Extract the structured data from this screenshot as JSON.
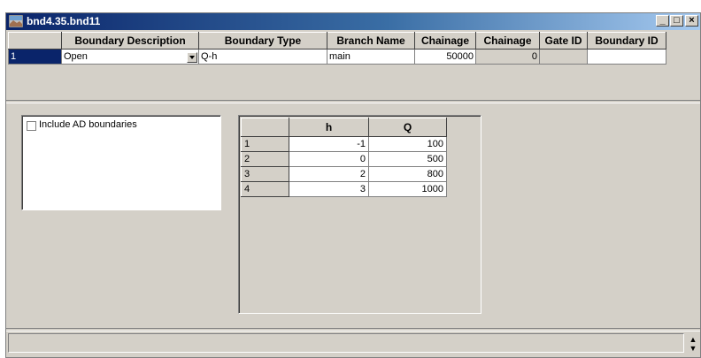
{
  "window": {
    "title": "bnd4.35.bnd11",
    "buttons": {
      "minimize": "_",
      "maximize": "□",
      "close": "×"
    }
  },
  "boundaries": {
    "columns": [
      "",
      "Boundary Description",
      "Boundary Type",
      "Branch Name",
      "Chainage",
      "Chainage",
      "Gate ID",
      "Boundary ID"
    ],
    "rows": [
      {
        "index": "1",
        "description": "Open",
        "type": "Q-h",
        "branch": "main",
        "chainage1": "50000",
        "chainage2": "0",
        "gate_id": "",
        "boundary_id": ""
      }
    ]
  },
  "ad": {
    "label": "Include AD boundaries",
    "checked": false
  },
  "hq": {
    "columns": [
      "",
      "h",
      "Q"
    ],
    "rows": [
      {
        "index": "1",
        "h": "-1",
        "q": "100"
      },
      {
        "index": "2",
        "h": "0",
        "q": "500"
      },
      {
        "index": "3",
        "h": "2",
        "q": "800"
      },
      {
        "index": "4",
        "h": "3",
        "q": "1000"
      }
    ]
  },
  "colors": {
    "selection": "#0a246a",
    "face": "#d4d0c8"
  },
  "icons": {
    "window": "app-icon",
    "dropdown": "dropdown-arrow-icon",
    "spin": "spin-arrows-icon"
  }
}
